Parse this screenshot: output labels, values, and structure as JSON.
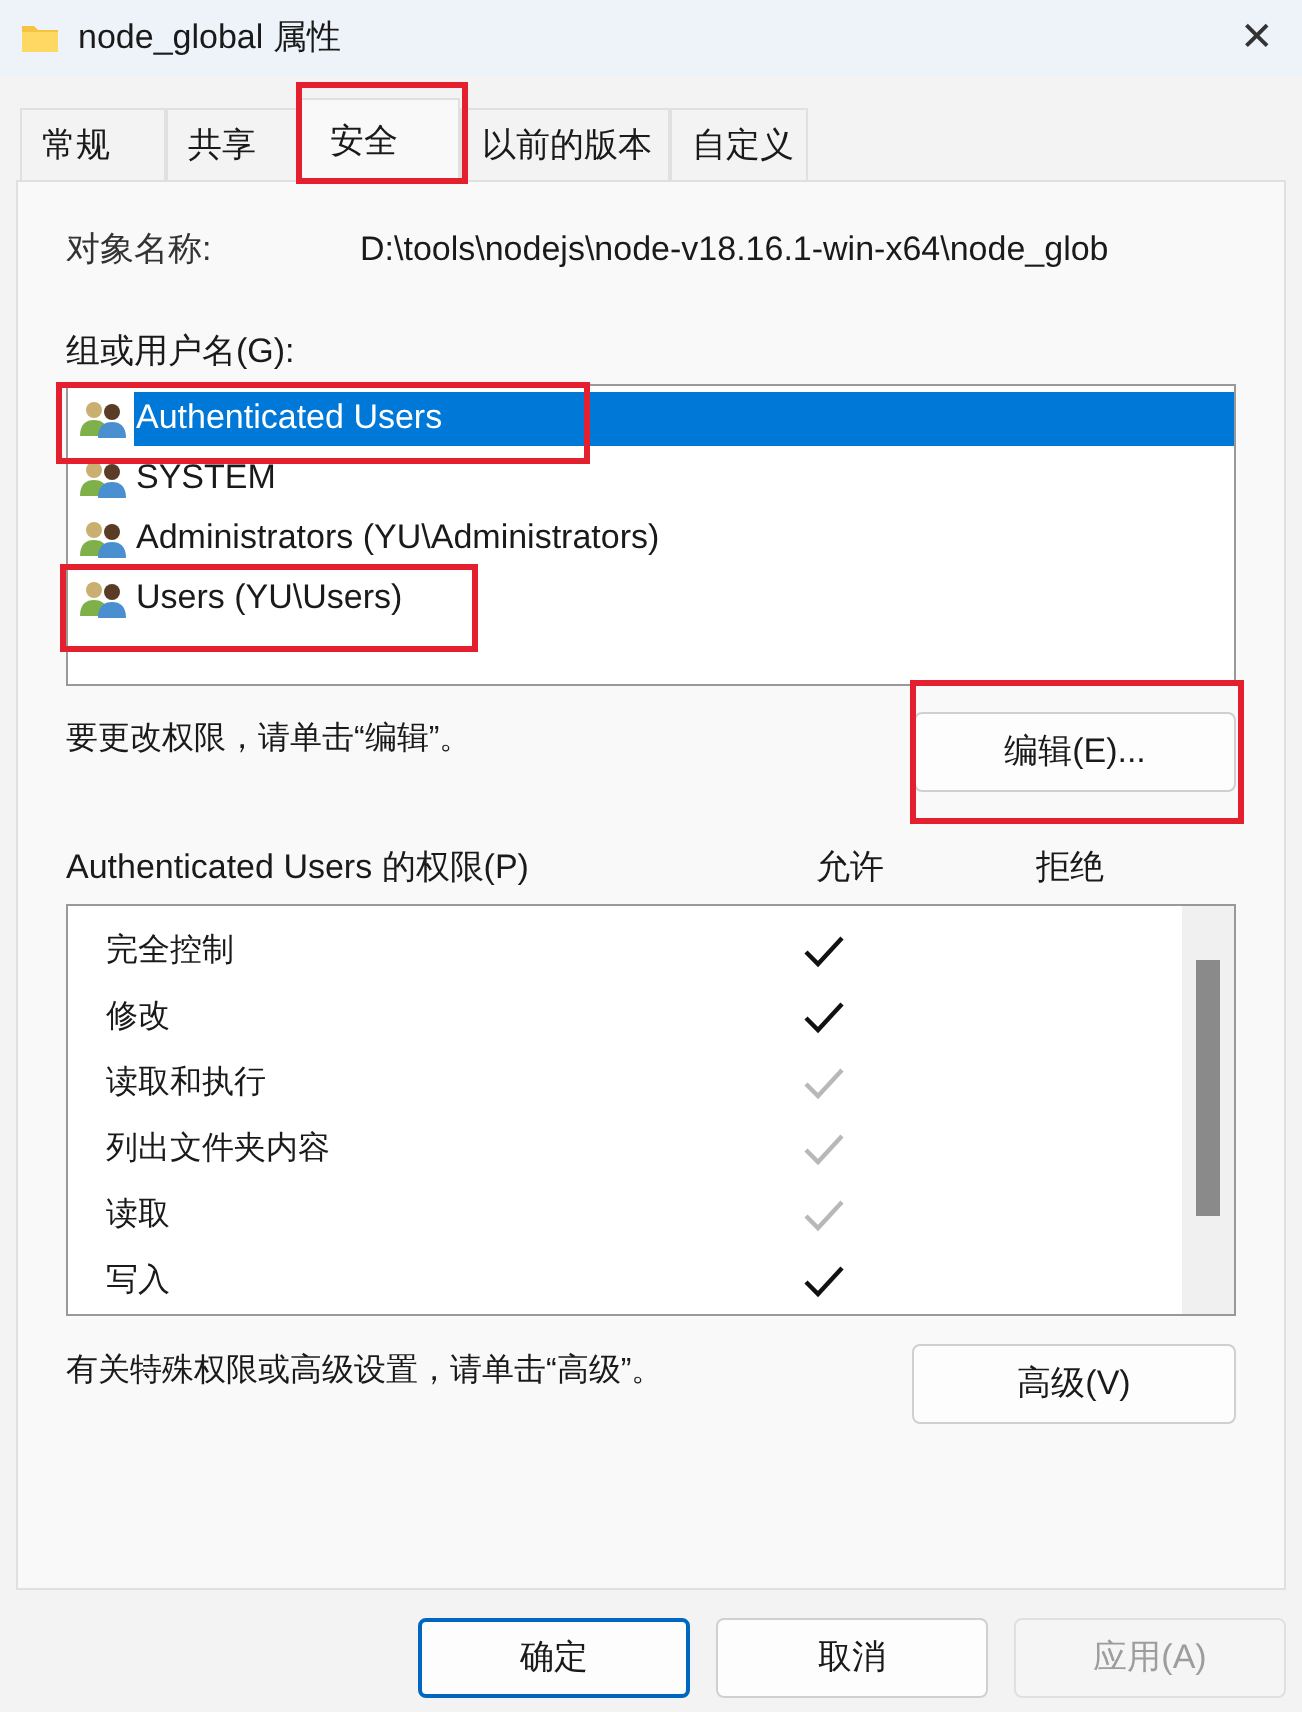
{
  "window": {
    "title": "node_global 属性",
    "close": "✕"
  },
  "tabs": [
    {
      "label": "常规",
      "selected": false,
      "highlighted": false
    },
    {
      "label": "共享",
      "selected": false,
      "highlighted": false
    },
    {
      "label": "安全",
      "selected": true,
      "highlighted": true
    },
    {
      "label": "以前的版本",
      "selected": false,
      "highlighted": false
    },
    {
      "label": "自定义",
      "selected": false,
      "highlighted": false
    }
  ],
  "object_name": {
    "label": "对象名称:",
    "value": "D:\\tools\\nodejs\\node-v18.16.1-win-x64\\node_glob"
  },
  "groups": {
    "label": "组或用户名(G):",
    "items": [
      {
        "name": "Authenticated Users",
        "selected": true,
        "highlighted": true
      },
      {
        "name": "SYSTEM",
        "selected": false,
        "highlighted": false
      },
      {
        "name": "Administrators (YU\\Administrators)",
        "selected": false,
        "highlighted": false
      },
      {
        "name": "Users (YU\\Users)",
        "selected": false,
        "highlighted": true
      }
    ]
  },
  "edit_hint": "要更改权限，请单击“编辑”。",
  "edit_button": {
    "label": "编辑(E)...",
    "highlighted": true
  },
  "permissions": {
    "title": "Authenticated Users 的权限(P)",
    "allow_header": "允许",
    "deny_header": "拒绝",
    "rows": [
      {
        "name": "完全控制",
        "allow": true,
        "allow_inherited": false
      },
      {
        "name": "修改",
        "allow": true,
        "allow_inherited": false
      },
      {
        "name": "读取和执行",
        "allow": true,
        "allow_inherited": true
      },
      {
        "name": "列出文件夹内容",
        "allow": true,
        "allow_inherited": true
      },
      {
        "name": "读取",
        "allow": true,
        "allow_inherited": true
      },
      {
        "name": "写入",
        "allow": true,
        "allow_inherited": false
      }
    ]
  },
  "advanced_hint": "有关特殊权限或高级设置，请单击“高级”。",
  "advanced_button": "高级(V)",
  "buttons": [
    {
      "label": "确定",
      "disabled": false,
      "default": true
    },
    {
      "label": "取消",
      "disabled": false,
      "default": false
    },
    {
      "label": "应用(A)",
      "disabled": true,
      "default": false
    }
  ]
}
